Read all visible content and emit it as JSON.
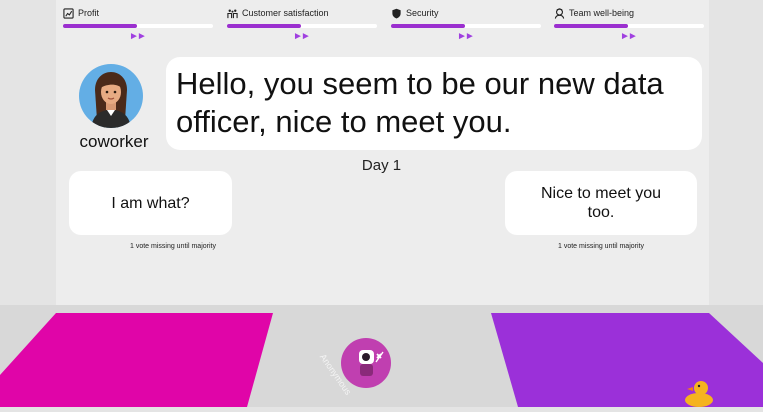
{
  "meters": [
    {
      "label": "Profit",
      "icon": "profit-icon",
      "fill": 0.5
    },
    {
      "label": "Customer satisfaction",
      "icon": "customer-satisfaction-icon",
      "fill": 0.5
    },
    {
      "label": "Security",
      "icon": "shield-icon",
      "fill": 0.5
    },
    {
      "label": "Team well-being",
      "icon": "team-icon",
      "fill": 0.5
    }
  ],
  "meter_arrows": "►►",
  "speaker": {
    "name": "coworker"
  },
  "dialogue": {
    "text": "Hello, you seem to be our new data officer, nice to meet you."
  },
  "day_label": "Day 1",
  "choices": [
    {
      "label": "I am what?",
      "votes": "1 vote missing until majority"
    },
    {
      "label": "Nice to meet you too.",
      "votes": "1 vote missing until majority"
    }
  ],
  "player": {
    "name": "Anonymous"
  },
  "colors": {
    "left_zone": "#e005a8",
    "right_zone": "#9b30d9",
    "meter_fill": "#9b2fcf",
    "player": "#c03fb0",
    "avatar_bg": "#63aee5"
  }
}
